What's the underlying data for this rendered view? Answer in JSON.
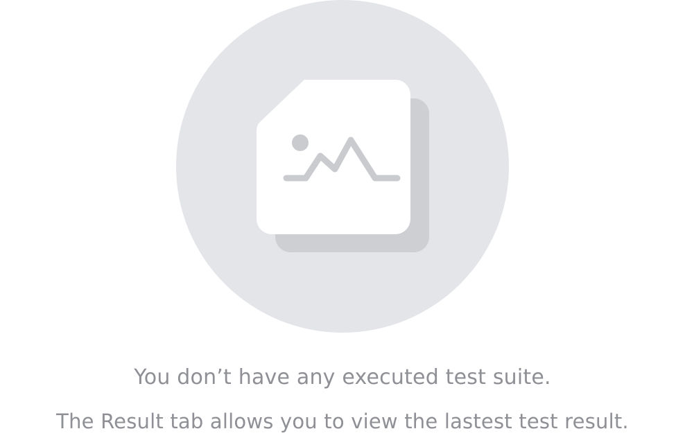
{
  "empty_state": {
    "illustration_icon": "image-placeholder-icon",
    "title": "You don’t have any executed test suite.",
    "description": "The Result tab allows you to view the lastest test result."
  },
  "colors": {
    "circle_background": "#e4e5e9",
    "card_shadow": "#cdcfd3",
    "card": "#ffffff",
    "icon_stroke": "#c9cbcf",
    "text": "#8e9096"
  }
}
